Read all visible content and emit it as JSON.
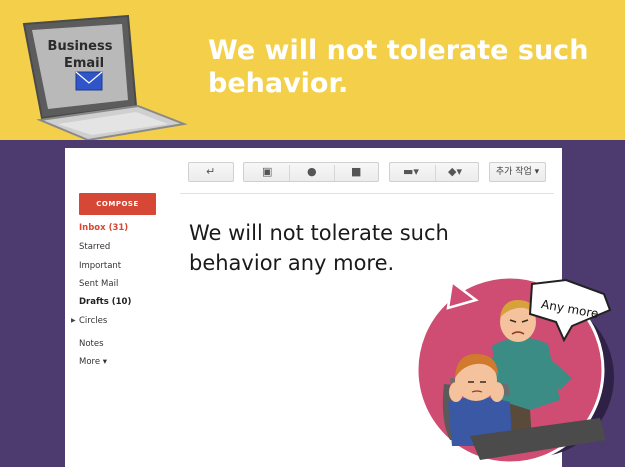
{
  "banner": {
    "headline_line1": "We will not tolerate such",
    "headline_line2": "behavior.",
    "laptop_label_line1": "Business",
    "laptop_label_line2": "Email"
  },
  "mail": {
    "compose_label": "COMPOSE",
    "more_actions_label": "추가 작업",
    "folders": [
      {
        "label": "Inbox (31)"
      },
      {
        "label": "Starred"
      },
      {
        "label": "Important"
      },
      {
        "label": "Sent Mail"
      },
      {
        "label": "Drafts (10)"
      },
      {
        "label": "Circles"
      },
      {
        "label": "Notes"
      },
      {
        "label": "More"
      }
    ],
    "message_line1": "We will not tolerate such",
    "message_line2": "behavior any more."
  },
  "scene": {
    "speech_bubble": "Any more"
  },
  "colors": {
    "yellow": "#f3cf4a",
    "purple": "#4d3a6f",
    "compose_red": "#d74735",
    "circle_pink": "#cf4c72"
  }
}
